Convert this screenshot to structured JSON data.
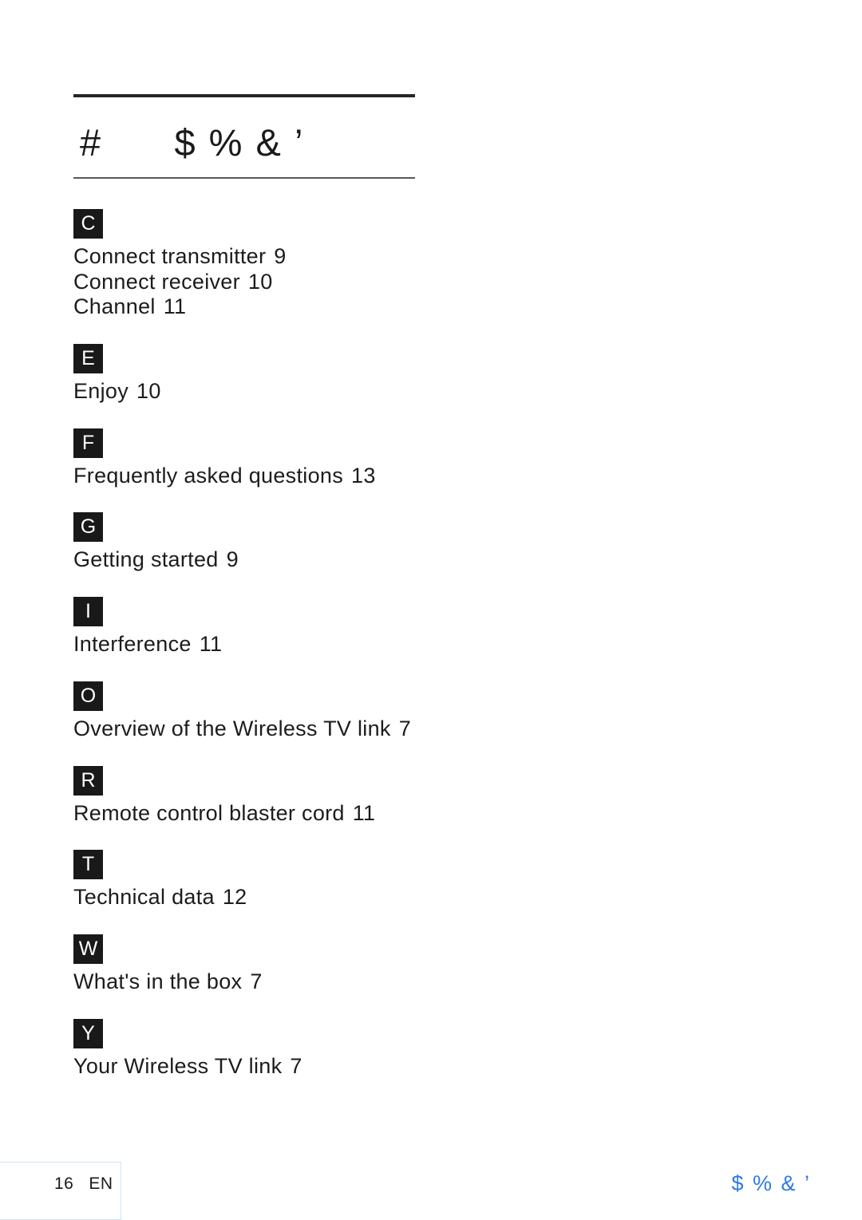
{
  "document": {
    "heading": "#      $ % & ’",
    "rule_color_top": "#262626",
    "rule_color_bottom": "#55585c"
  },
  "index": {
    "groups": [
      {
        "letter": "C",
        "entries": [
          {
            "title": "Connect transmitter",
            "page": "9"
          },
          {
            "title": "Connect receiver",
            "page": "10"
          },
          {
            "title": "Channel",
            "page": "11"
          }
        ]
      },
      {
        "letter": "E",
        "entries": [
          {
            "title": "Enjoy",
            "page": "10"
          }
        ]
      },
      {
        "letter": "F",
        "entries": [
          {
            "title": "Frequently asked questions",
            "page": "13"
          }
        ]
      },
      {
        "letter": "G",
        "entries": [
          {
            "title": "Getting started",
            "page": "9"
          }
        ]
      },
      {
        "letter": "I",
        "entries": [
          {
            "title": "Interference",
            "page": "11"
          }
        ]
      },
      {
        "letter": "O",
        "entries": [
          {
            "title": "Overview of the Wireless TV link",
            "page": "7"
          }
        ]
      },
      {
        "letter": "R",
        "entries": [
          {
            "title": "Remote control blaster cord",
            "page": "11"
          }
        ]
      },
      {
        "letter": "T",
        "entries": [
          {
            "title": "Technical data",
            "page": "12"
          }
        ]
      },
      {
        "letter": "W",
        "entries": [
          {
            "title": "What's in the box",
            "page": "7"
          }
        ]
      },
      {
        "letter": "Y",
        "entries": [
          {
            "title": "Your Wireless TV link",
            "page": "7"
          }
        ]
      }
    ]
  },
  "footer": {
    "page_number": "16",
    "language": "EN",
    "page_info": "16   EN",
    "right_label": "$ % & ’",
    "right_label_color": "#2f7ae5",
    "box_border_color": "#cfe2f5"
  }
}
